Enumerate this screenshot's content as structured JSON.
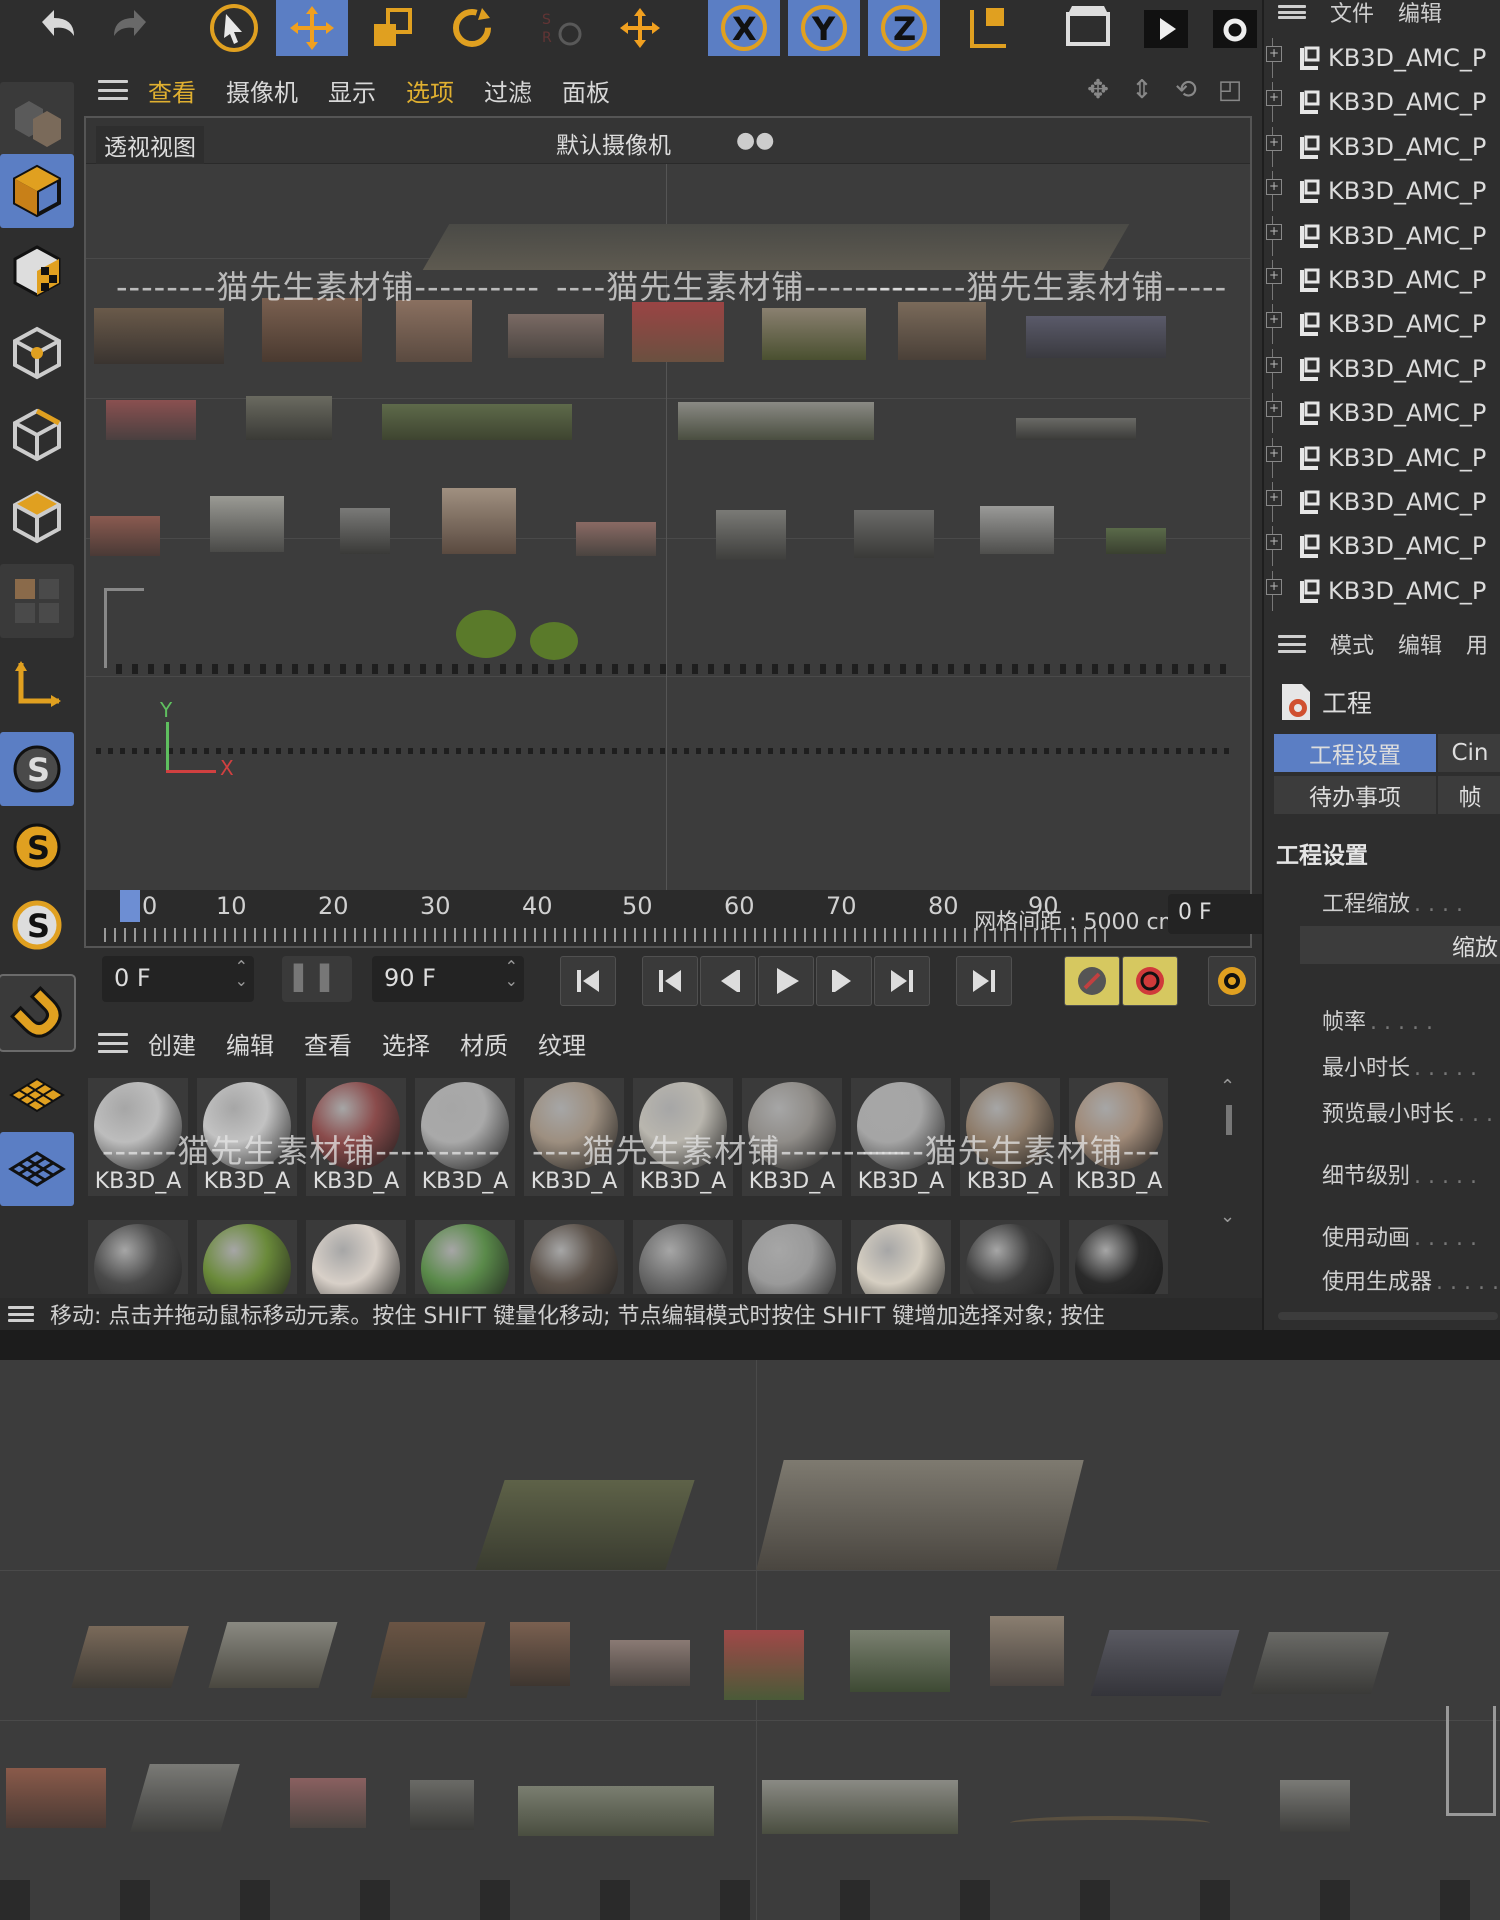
{
  "top_toolbar": {
    "icons": [
      "undo-icon",
      "redo-icon",
      "select-icon",
      "move-icon",
      "scale-icon",
      "rotate-icon",
      "psr-icon",
      "axis-move-icon",
      "x-axis-icon",
      "y-axis-icon",
      "z-axis-icon",
      "coordinate-icon",
      "render-view-icon",
      "render-icon",
      "render-settings-icon"
    ],
    "axis_labels": [
      "X",
      "Y",
      "Z"
    ],
    "psr_label": "S R"
  },
  "viewport": {
    "menu": [
      "查看",
      "摄像机",
      "显示",
      "选项",
      "过滤",
      "面板"
    ],
    "title": "透视视图",
    "camera": "默认摄像机",
    "grid_spacing": "网格间距 : 5000 cm",
    "axis_y": "Y",
    "axis_x": "X"
  },
  "watermark": "猫先生素材铺",
  "timeline": {
    "ticks": [
      "0",
      "10",
      "20",
      "30",
      "40",
      "50",
      "60",
      "70",
      "80",
      "90"
    ],
    "current": "0 F",
    "start": "0 F",
    "end": "90 F"
  },
  "material_panel": {
    "menu": [
      "创建",
      "编辑",
      "查看",
      "选择",
      "材质",
      "纹理"
    ],
    "labels": [
      "KB3D_A",
      "KB3D_A",
      "KB3D_A",
      "KB3D_A",
      "KB3D_A",
      "KB3D_A",
      "KB3D_A",
      "KB3D_A",
      "KB3D_A",
      "KB3D_A"
    ],
    "colors_row1": [
      "#bdbdbd",
      "#c2c2c2",
      "#8a4b4b",
      "#a9a9a9",
      "#9d8f80",
      "#b9b6ae",
      "#8f8c88",
      "#a5a5a5",
      "#8e7c6a",
      "#a08a78"
    ],
    "colors_row2": [
      "#4a4a4a",
      "#6a8a3a",
      "#d8d0c8",
      "#5a8a4a",
      "#5a5048",
      "#6a6a6a",
      "#9a9a9a",
      "#d6cfc2",
      "#3e3e3e",
      "#2a2a2a"
    ]
  },
  "status": "移动: 点击并拖动鼠标移动元素。按住 SHIFT 键量化移动; 节点编辑模式时按住 SHIFT 键增加选择对象; 按住",
  "right_panel": {
    "object_menu": [
      "文件",
      "编辑"
    ],
    "objects": [
      "KB3D_AMC_P",
      "KB3D_AMC_P",
      "KB3D_AMC_P",
      "KB3D_AMC_P",
      "KB3D_AMC_P",
      "KB3D_AMC_P",
      "KB3D_AMC_P",
      "KB3D_AMC_P",
      "KB3D_AMC_P",
      "KB3D_AMC_P",
      "KB3D_AMC_P",
      "KB3D_AMC_P",
      "KB3D_AMC_P"
    ],
    "attr_menu": [
      "模式",
      "编辑",
      "用"
    ],
    "attr_title": "工程",
    "tabs": [
      "工程设置",
      "Cin",
      "待办事项",
      "帧"
    ],
    "section": "工程设置",
    "project_scale": "工程缩放",
    "scale_button": "缩放",
    "rows": [
      "帧率",
      "最小时长",
      "预览最小时长",
      "细节级别",
      "使用动画",
      "使用生成器"
    ]
  }
}
